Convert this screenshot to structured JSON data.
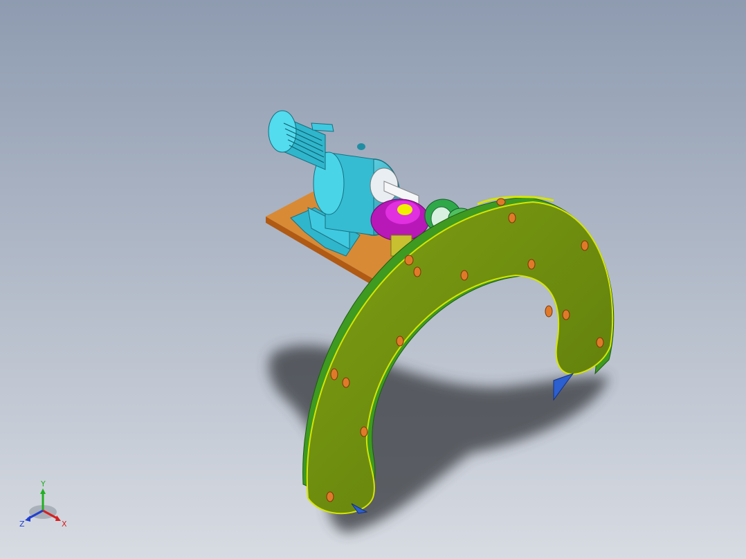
{
  "viewport": {
    "background_top": "#8e9bb0",
    "background_bottom": "#d7dbe2"
  },
  "model": {
    "colors": {
      "motor": "#3fc9e0",
      "motor_dark": "#1f8ea3",
      "base_plate": "#c06a1a",
      "base_plate_top": "#d98a35",
      "ring_face": "#6f8f10",
      "ring_edge": "#3e9a20",
      "ring_rim": "#d6e600",
      "holes": "#e07a2a",
      "bevel_gear": "#c020c0",
      "gear_hub": "#f0f000",
      "pinion": "#2fa84a",
      "legs": "#2c5fd0",
      "shadow": "#3d3f45"
    }
  },
  "triad": {
    "labels": {
      "x": "X",
      "y": "Y",
      "z": "Z"
    },
    "colors": {
      "x": "#d62020",
      "y": "#20b020",
      "z": "#2040d0"
    }
  }
}
